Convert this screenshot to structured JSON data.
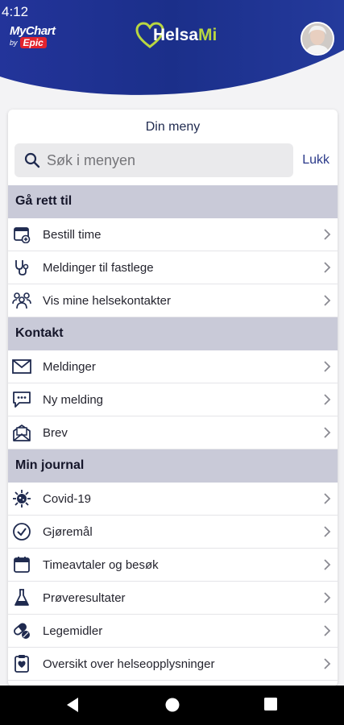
{
  "status": {
    "time": "4:12"
  },
  "header": {
    "mychart_text": "MyChart",
    "by_text": "by",
    "epic_text": "Epic",
    "brand_prefix": "Helsa",
    "brand_suffix": "Mi",
    "colors": {
      "header_bg": "#1b2f8a",
      "brand_green": "#b8d641"
    }
  },
  "menu": {
    "title": "Din meny",
    "search_placeholder": "Søk i menyen",
    "close_label": "Lukk",
    "sections": [
      {
        "title": "Gå rett til",
        "items": [
          {
            "label": "Bestill time",
            "icon": "calendar-add-icon"
          },
          {
            "label": "Meldinger til fastlege",
            "icon": "stethoscope-icon"
          },
          {
            "label": "Vis mine helsekontakter",
            "icon": "people-icon"
          }
        ]
      },
      {
        "title": "Kontakt",
        "items": [
          {
            "label": "Meldinger",
            "icon": "envelope-icon"
          },
          {
            "label": "Ny melding",
            "icon": "chat-icon"
          },
          {
            "label": "Brev",
            "icon": "letter-icon"
          }
        ]
      },
      {
        "title": "Min journal",
        "items": [
          {
            "label": "Covid-19",
            "icon": "virus-icon"
          },
          {
            "label": "Gjøremål",
            "icon": "check-circle-icon"
          },
          {
            "label": "Timeavtaler og besøk",
            "icon": "calendar-icon"
          },
          {
            "label": "Prøveresultater",
            "icon": "flask-icon"
          },
          {
            "label": "Legemidler",
            "icon": "pills-icon"
          },
          {
            "label": "Oversikt over helseopplysninger",
            "icon": "clipboard-heart-icon"
          }
        ]
      }
    ]
  }
}
